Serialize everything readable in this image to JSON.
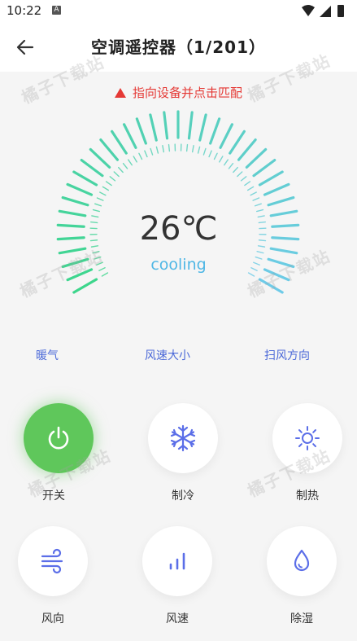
{
  "status_bar": {
    "time": "10:22",
    "notification_badge": "A"
  },
  "header": {
    "title": "空调遥控器（1/201）"
  },
  "warning": {
    "text": "指向设备并点击匹配"
  },
  "display": {
    "temperature": "26℃",
    "mode": "cooling"
  },
  "gauge": {
    "colors": {
      "warm": "#3dd68c",
      "cool": "#6ecbe8"
    },
    "level": 0.5
  },
  "labels": {
    "heat": "暖气",
    "fan_size": "风速大小",
    "swing": "扫风方向"
  },
  "buttons": [
    {
      "label": "开关",
      "icon": "power-icon"
    },
    {
      "label": "制冷",
      "icon": "snowflake-icon"
    },
    {
      "label": "制热",
      "icon": "sun-icon"
    },
    {
      "label": "风向",
      "icon": "wind-icon"
    },
    {
      "label": "风速",
      "icon": "bars-icon"
    },
    {
      "label": "除湿",
      "icon": "drop-icon"
    }
  ],
  "watermark": "橘子下载站",
  "colors": {
    "accent": "#4a68d8",
    "power": "#5fc75b",
    "warning": "#e53935",
    "mode": "#4fb7e5"
  }
}
